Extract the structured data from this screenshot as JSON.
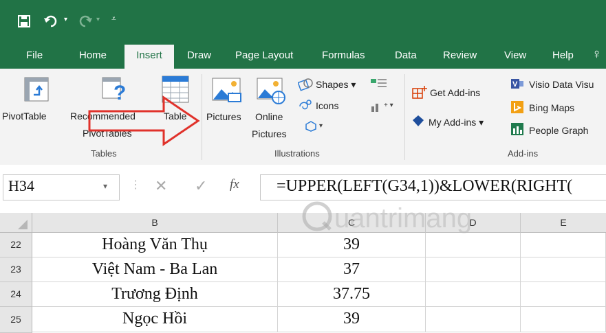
{
  "quick_access": {
    "icons": [
      "save-icon",
      "undo-icon",
      "redo-icon",
      "customize-icon"
    ]
  },
  "tabs": [
    {
      "label": "File"
    },
    {
      "label": "Home"
    },
    {
      "label": "Insert"
    },
    {
      "label": "Draw"
    },
    {
      "label": "Page Layout"
    },
    {
      "label": "Formulas"
    },
    {
      "label": "Data"
    },
    {
      "label": "Review"
    },
    {
      "label": "View"
    },
    {
      "label": "Help"
    }
  ],
  "ribbon": {
    "tables": {
      "pivot_table": "PivotTable",
      "recommended_line1": "Recommended",
      "recommended_line2": "PivotTables",
      "table": "Table",
      "group": "Tables"
    },
    "illustrations": {
      "pictures": "Pictures",
      "online_line1": "Online",
      "online_line2": "Pictures",
      "shapes": "Shapes",
      "icons": "Icons",
      "group": "Illustrations"
    },
    "addins": {
      "get": "Get Add-ins",
      "my": "My Add-ins",
      "visio": "Visio Data Visu",
      "bing": "Bing Maps",
      "people": "People Graph",
      "group": "Add-ins"
    }
  },
  "formula_bar": {
    "name_box": "H34",
    "fx": "fx",
    "formula": "=UPPER(LEFT(G34,1))&LOWER(RIGHT("
  },
  "grid": {
    "columns": [
      "B",
      "C",
      "D",
      "E"
    ],
    "rows": [
      {
        "num": "22",
        "b": "Hoàng Văn Thụ",
        "c": "39"
      },
      {
        "num": "23",
        "b": "Việt Nam - Ba Lan",
        "c": "37"
      },
      {
        "num": "24",
        "b": "Trương Định",
        "c": "37.75"
      },
      {
        "num": "25",
        "b": "Ngọc Hồi",
        "c": "39"
      }
    ]
  },
  "watermark": "uantrimang",
  "colors": {
    "excel_green": "#217346",
    "arrow_red": "#e0322b"
  }
}
